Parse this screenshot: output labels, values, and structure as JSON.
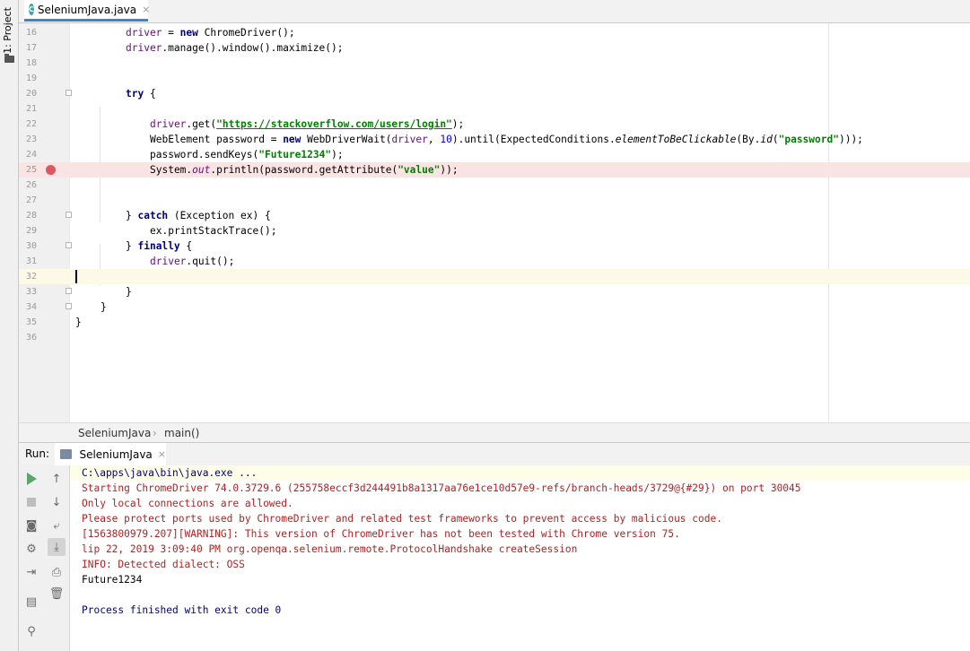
{
  "left_strip": {
    "project_label": "1: Project"
  },
  "editor_tab": {
    "file_name": "SeleniumJava.java",
    "close": "×",
    "icon_letter": "C"
  },
  "code_lines": [
    {
      "n": "16"
    },
    {
      "n": "17"
    },
    {
      "n": "18"
    },
    {
      "n": "19"
    },
    {
      "n": "20"
    },
    {
      "n": "21"
    },
    {
      "n": "22"
    },
    {
      "n": "23"
    },
    {
      "n": "24"
    },
    {
      "n": "25"
    },
    {
      "n": "26"
    },
    {
      "n": "27"
    },
    {
      "n": "28"
    },
    {
      "n": "29"
    },
    {
      "n": "30"
    },
    {
      "n": "31"
    },
    {
      "n": "32"
    },
    {
      "n": "33"
    },
    {
      "n": "34"
    },
    {
      "n": "35"
    },
    {
      "n": "36"
    }
  ],
  "code": {
    "l16": [
      "driver",
      " = ",
      "new",
      " ChromeDriver();"
    ],
    "l17": [
      "driver",
      ".manage().window().maximize();"
    ],
    "l20": [
      "try",
      " {"
    ],
    "l22": [
      "driver",
      ".get(",
      "\"https://stackoverflow.com/users/login\"",
      ");"
    ],
    "l23": [
      "WebElement password = ",
      "new",
      " WebDriverWait(",
      "driver",
      ", ",
      "10",
      ").until(ExpectedConditions.",
      "elementToBeClickable",
      "(By.",
      "id",
      "(",
      "\"password\"",
      ")));"
    ],
    "l24": [
      "password.sendKeys(",
      "\"Future1234\"",
      ");"
    ],
    "l25": [
      "System.",
      "out",
      ".println(password.getAttribute(",
      "\"value\"",
      "));"
    ],
    "l28": [
      "} ",
      "catch",
      " (Exception ex) {"
    ],
    "l29": [
      "ex.printStackTrace();"
    ],
    "l30": [
      "} ",
      "finally",
      " {"
    ],
    "l31": [
      "driver",
      ".quit();"
    ],
    "l33": [
      "}"
    ],
    "l34": [
      "}"
    ],
    "l35": [
      "}"
    ]
  },
  "breadcrumb": {
    "class_name": "SeleniumJava",
    "separator": "›",
    "method": "main()"
  },
  "run_panel": {
    "label": "Run:",
    "tab_name": "SeleniumJava",
    "close": "×",
    "console": [
      {
        "kind": "cmd",
        "text": "C:\\apps\\java\\bin\\java.exe ..."
      },
      {
        "kind": "err",
        "text": "Starting ChromeDriver 74.0.3729.6 (255758eccf3d244491b8a1317aa76e1ce10d57e9-refs/branch-heads/3729@{#29}) on port 30045"
      },
      {
        "kind": "err",
        "text": "Only local connections are allowed."
      },
      {
        "kind": "err",
        "text": "Please protect ports used by ChromeDriver and related test frameworks to prevent access by malicious code."
      },
      {
        "kind": "err",
        "text": "[1563800979.207][WARNING]: This version of ChromeDriver has not been tested with Chrome version 75."
      },
      {
        "kind": "err",
        "text": "lip 22, 2019 3:09:40 PM org.openqa.selenium.remote.ProtocolHandshake createSession"
      },
      {
        "kind": "err",
        "text": "INFO: Detected dialect: OSS"
      },
      {
        "kind": "out",
        "text": "Future1234"
      },
      {
        "kind": "out",
        "text": ""
      },
      {
        "kind": "done",
        "text": "Process finished with exit code 0"
      }
    ]
  },
  "colors": {
    "keyword": "#000080",
    "string": "#008000",
    "field": "#660e7a",
    "number": "#0000ff",
    "stderr": "#b22222",
    "breakpoint": "#db5860",
    "breakpoint_line": "#fae3e3",
    "current_line": "#fcfae7",
    "tab_underline": "#4083c9"
  },
  "icons": {
    "toolbar": [
      "rerun-icon",
      "stop-icon",
      "camera-icon",
      "settings-icon",
      "exit-icon",
      "layout-icon",
      "pin-icon",
      "up-arrow-icon",
      "down-arrow-icon",
      "soft-wrap-icon",
      "scroll-to-end-icon",
      "print-icon",
      "trash-icon"
    ]
  }
}
